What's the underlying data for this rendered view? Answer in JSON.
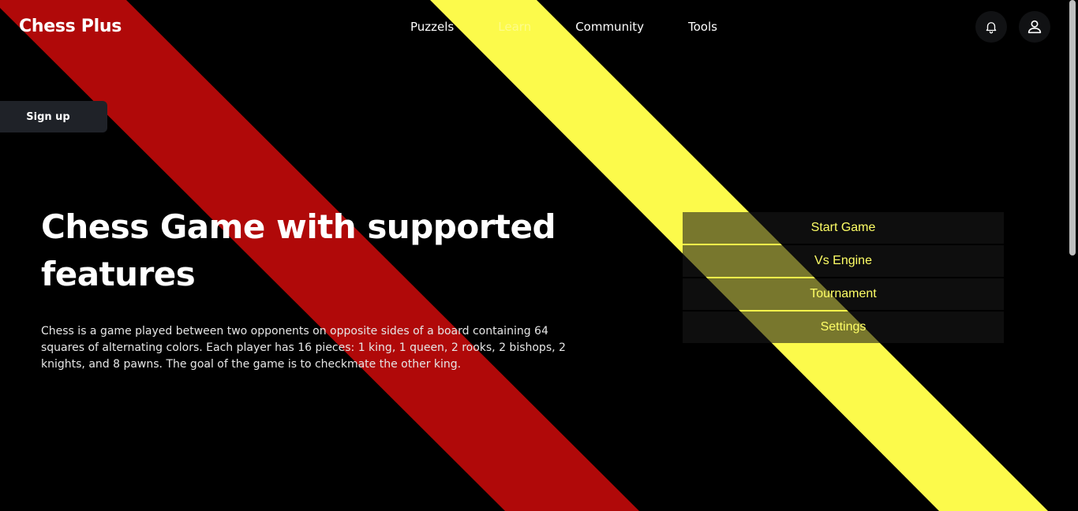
{
  "brand": {
    "name": "Chess Plus"
  },
  "nav": {
    "items": [
      {
        "label": "Puzzels"
      },
      {
        "label": "Learn"
      },
      {
        "label": "Community"
      },
      {
        "label": "Tools"
      }
    ]
  },
  "header": {
    "icons": {
      "notifications": "bell-icon",
      "profile": "user-icon"
    }
  },
  "signup": {
    "label": "Sign up"
  },
  "hero": {
    "title": "Chess Game with supported features",
    "description": "Chess is a game played between two opponents on opposite sides of a board containing 64 squares of alternating colors. Each player has 16 pieces: 1 king, 1 queen, 2 rooks, 2 bishops, 2 knights, and 8 pawns. The goal of the game is to checkmate the other king."
  },
  "menu": {
    "items": [
      {
        "label": "Start Game"
      },
      {
        "label": "Vs Engine"
      },
      {
        "label": "Tournament"
      },
      {
        "label": "Settings"
      }
    ]
  },
  "colors": {
    "background": "#000000",
    "red_stripe": "#b00909",
    "yellow_stripe": "#fcfa4b",
    "menu_text": "#ffff66"
  }
}
